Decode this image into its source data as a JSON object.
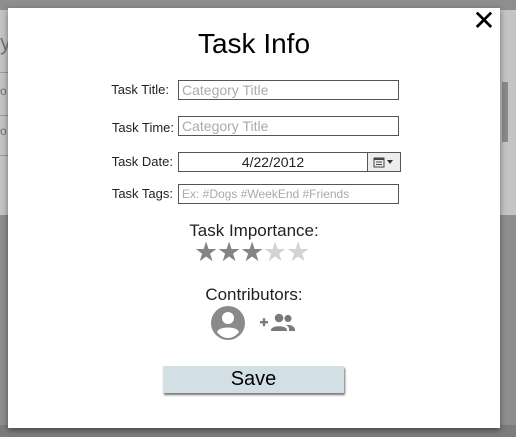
{
  "background": {
    "left_fragments": [
      "y",
      "o",
      "o"
    ]
  },
  "modal": {
    "close_label": "✕",
    "title": "Task Info",
    "fields": {
      "task_title": {
        "label": "Task Title:",
        "value": "",
        "placeholder": "Category Title"
      },
      "task_time": {
        "label": "Task Time:",
        "value": "",
        "placeholder": "Category Title"
      },
      "task_date": {
        "label": "Task Date:",
        "value": "4/22/2012"
      },
      "task_tags": {
        "label": "Task Tags:",
        "value": "",
        "placeholder": "Ex: #Dogs #WeekEnd #Friends"
      }
    },
    "importance": {
      "label": "Task Importance:",
      "rating": 3,
      "max": 5,
      "filled_color": "#848484",
      "empty_color": "#d3d3d3"
    },
    "contributors": {
      "label": "Contributors:",
      "icons": [
        "account-circle-icon",
        "group-add-icon"
      ]
    },
    "save_label": "Save",
    "save_color": "#d2e0e6"
  }
}
